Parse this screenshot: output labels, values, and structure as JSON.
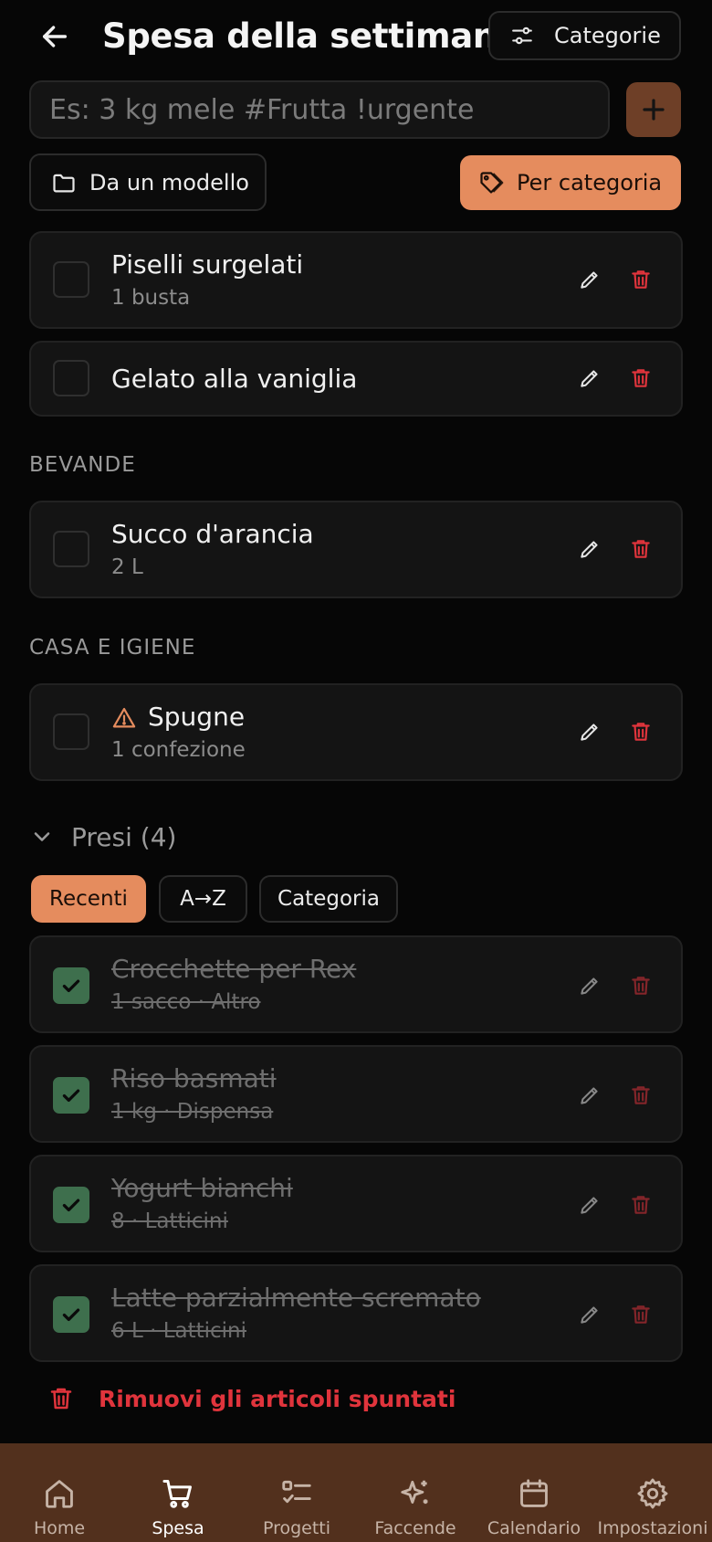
{
  "header": {
    "title": "Spesa della settimana",
    "categories_label": "Categorie"
  },
  "add": {
    "placeholder": "Es: 3 kg mele #Frutta !urgente",
    "value": ""
  },
  "actions": {
    "template_label": "Da un modello",
    "group_by_label": "Per categoria"
  },
  "items": [
    {
      "name": "Piselli surgelati",
      "sub": "1 busta"
    },
    {
      "name": "Gelato alla vaniglia",
      "sub": ""
    }
  ],
  "sections": [
    {
      "title": "BEVANDE",
      "items": [
        {
          "name": "Succo d'arancia",
          "sub": "2 L"
        }
      ]
    },
    {
      "title": "CASA E IGIENE",
      "items": [
        {
          "name": "Spugne",
          "sub": "1 confezione",
          "urgent": true
        }
      ]
    }
  ],
  "taken": {
    "label": "Presi (4)",
    "sorts": [
      "Recenti",
      "A→Z",
      "Categoria"
    ],
    "active_sort": "Recenti",
    "items": [
      {
        "name": "Crocchette per Rex",
        "sub": "1 sacco · Altro"
      },
      {
        "name": "Riso basmati",
        "sub": "1 kg · Dispensa"
      },
      {
        "name": "Yogurt bianchi",
        "sub": "8 · Latticini"
      },
      {
        "name": "Latte parzialmente scremato",
        "sub": "6 L · Latticini"
      }
    ],
    "remove_label": "Rimuovi gli articoli spuntati"
  },
  "nav": [
    {
      "label": "Home",
      "icon": "home-icon"
    },
    {
      "label": "Spesa",
      "icon": "cart-icon",
      "active": true
    },
    {
      "label": "Progetti",
      "icon": "checklist-icon"
    },
    {
      "label": "Faccende",
      "icon": "sparkles-icon"
    },
    {
      "label": "Calendario",
      "icon": "calendar-icon"
    },
    {
      "label": "Impostazioni",
      "icon": "gear-icon"
    }
  ],
  "colors": {
    "accent": "#e58c5e",
    "danger": "#e0343c",
    "checked": "#3e6f4d",
    "nav_bg": "#52301d"
  }
}
